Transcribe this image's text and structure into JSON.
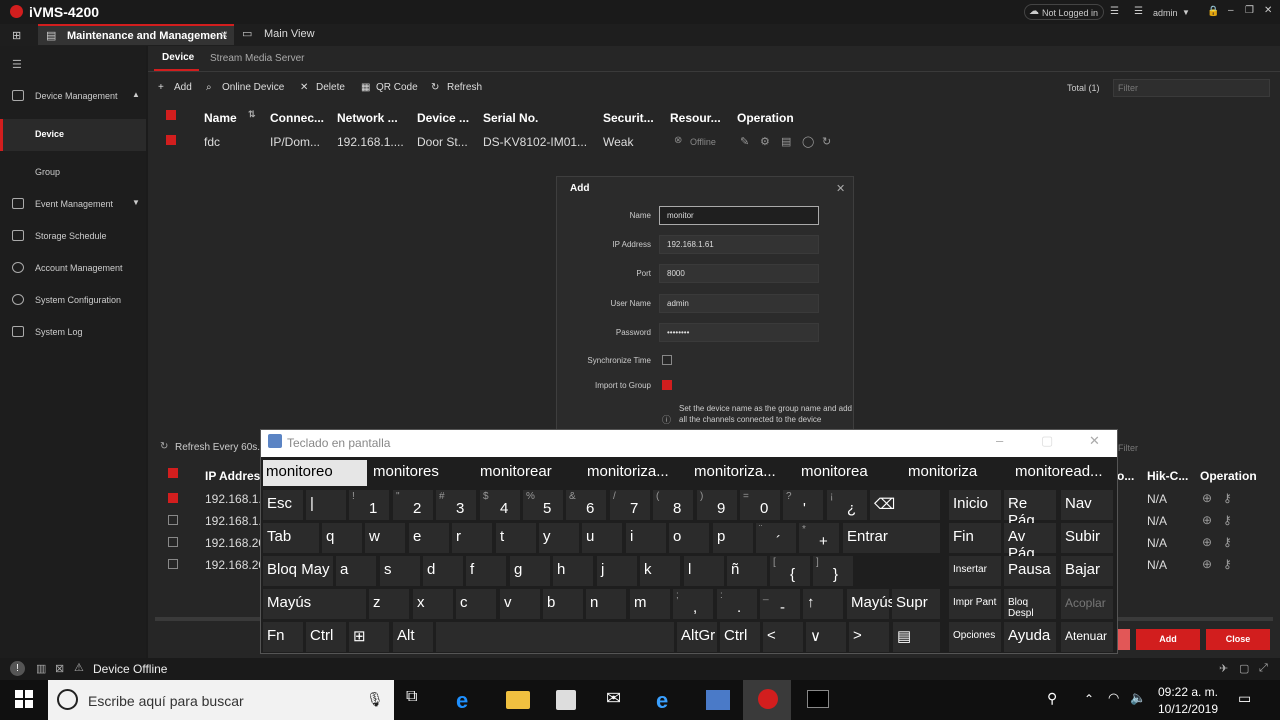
{
  "app": {
    "title": "iVMS-4200",
    "login_status": "Not Logged in",
    "user": "admin"
  },
  "tabs": [
    {
      "label": "Maintenance and Management"
    },
    {
      "label": "Main View"
    }
  ],
  "sidebar": {
    "items": [
      {
        "label": "Device Management"
      },
      {
        "label": "Device"
      },
      {
        "label": "Group"
      },
      {
        "label": "Event Management"
      },
      {
        "label": "Storage Schedule"
      },
      {
        "label": "Account Management"
      },
      {
        "label": "System Configuration"
      },
      {
        "label": "System Log"
      }
    ]
  },
  "subtabs": {
    "device": "Device",
    "sms": "Stream Media Server"
  },
  "toolbar": {
    "add": "Add",
    "online": "Online Device",
    "delete": "Delete",
    "qr": "QR Code",
    "refresh": "Refresh",
    "total": "Total (1)",
    "filter_placeholder": "Filter"
  },
  "device_table": {
    "headers": [
      "Name",
      "Connec...",
      "Network ...",
      "Device ...",
      "Serial No.",
      "Securit...",
      "Resour...",
      "Operation"
    ],
    "rows": [
      {
        "name": "fdc",
        "conn": "IP/Dom...",
        "network": "192.168.1....",
        "device": "Door St...",
        "serial": "DS-KV8102-IM01...",
        "security": "Weak",
        "resource": "Offline"
      }
    ]
  },
  "dialog": {
    "title": "Add",
    "fields": [
      {
        "label": "Name",
        "value": "monitor"
      },
      {
        "label": "IP Address",
        "value": "192.168.1.61"
      },
      {
        "label": "Port",
        "value": "8000"
      },
      {
        "label": "User Name",
        "value": "admin"
      },
      {
        "label": "Password",
        "value": "••••••••"
      }
    ],
    "sync_label": "Synchronize Time",
    "import_label": "Import to Group",
    "hint": "Set the device name as the group name and add all the channels connected to the device",
    "add_button": "Add",
    "close_button": "Close"
  },
  "lower": {
    "refresh": "Refresh Every 60s.",
    "filter": "Filter",
    "headers": {
      "ip": "IP Address",
      "hik": "Hik-C...",
      "op": "Operation",
      "p": "o..."
    },
    "rows": [
      {
        "ip": "192.168.1.",
        "hik": "N/A"
      },
      {
        "ip": "192.168.1.",
        "hik": "N/A"
      },
      {
        "ip": "192.168.20",
        "hik": "N/A"
      },
      {
        "ip": "192.168.20",
        "hik": "N/A"
      }
    ]
  },
  "status": {
    "text": "Device Offline"
  },
  "osk": {
    "title": "Teclado en pantalla",
    "suggestions": [
      "monitoreo",
      "monitores",
      "monitorear",
      "monitoriza...",
      "monitoriza...",
      "monitorea",
      "monitoriza",
      "monitoread..."
    ],
    "right_keys": [
      "Inicio",
      "Re Pág",
      "Nav",
      "Fin",
      "Av Pág",
      "Subir",
      "Insertar",
      "Pausa",
      "Bajar",
      "Impr Pant",
      "Bloq Despl",
      "Acoplar",
      "Opciones",
      "Ayuda",
      "Atenuar"
    ],
    "row1": [
      [
        "Esc",
        ""
      ],
      [
        "|",
        ""
      ],
      [
        "1",
        "!"
      ],
      [
        "2",
        "\""
      ],
      [
        "3",
        "#"
      ],
      [
        "4",
        "$"
      ],
      [
        "5",
        "%"
      ],
      [
        "6",
        "&"
      ],
      [
        "7",
        "/"
      ],
      [
        "8",
        "("
      ],
      [
        "9",
        ")"
      ],
      [
        "0",
        "="
      ],
      [
        "'",
        "?"
      ],
      [
        "¿",
        "¡"
      ]
    ],
    "row2": [
      [
        "Tab",
        ""
      ],
      [
        "q",
        ""
      ],
      [
        "w",
        ""
      ],
      [
        "e",
        ""
      ],
      [
        "r",
        ""
      ],
      [
        "t",
        ""
      ],
      [
        "y",
        ""
      ],
      [
        "u",
        ""
      ],
      [
        "i",
        ""
      ],
      [
        "o",
        ""
      ],
      [
        "p",
        ""
      ],
      [
        "´",
        "¨"
      ],
      [
        "+",
        "*"
      ],
      [
        "Entrar",
        ""
      ]
    ],
    "row3": [
      [
        "Bloq May",
        ""
      ],
      [
        "a",
        ""
      ],
      [
        "s",
        ""
      ],
      [
        "d",
        ""
      ],
      [
        "f",
        ""
      ],
      [
        "g",
        ""
      ],
      [
        "h",
        ""
      ],
      [
        "j",
        ""
      ],
      [
        "k",
        ""
      ],
      [
        "l",
        ""
      ],
      [
        "ñ",
        ""
      ],
      [
        "{",
        "["
      ],
      [
        "}",
        "]"
      ]
    ],
    "row4": [
      [
        "Mayús",
        ""
      ],
      [
        "z",
        ""
      ],
      [
        "x",
        ""
      ],
      [
        "c",
        ""
      ],
      [
        "v",
        ""
      ],
      [
        "b",
        ""
      ],
      [
        "n",
        ""
      ],
      [
        "m",
        ""
      ],
      [
        ",",
        ";"
      ],
      [
        ".",
        ":"
      ],
      [
        "-",
        "_"
      ],
      [
        "↑",
        ""
      ],
      [
        "Mayús",
        ""
      ],
      [
        "Supr",
        ""
      ]
    ],
    "row5": [
      [
        "Fn",
        ""
      ],
      [
        "Ctrl",
        ""
      ],
      [
        "⊞",
        ""
      ],
      [
        "Alt",
        ""
      ],
      [
        "",
        ""
      ],
      [
        "AltGr",
        ""
      ],
      [
        "Ctrl",
        ""
      ],
      [
        "<",
        ""
      ],
      [
        "∨",
        ""
      ],
      [
        ">",
        ""
      ],
      [
        "▤",
        ""
      ]
    ]
  },
  "taskbar": {
    "search": "Escribe aquí para buscar",
    "time": "09:22 a. m.",
    "date": "10/12/2019"
  }
}
